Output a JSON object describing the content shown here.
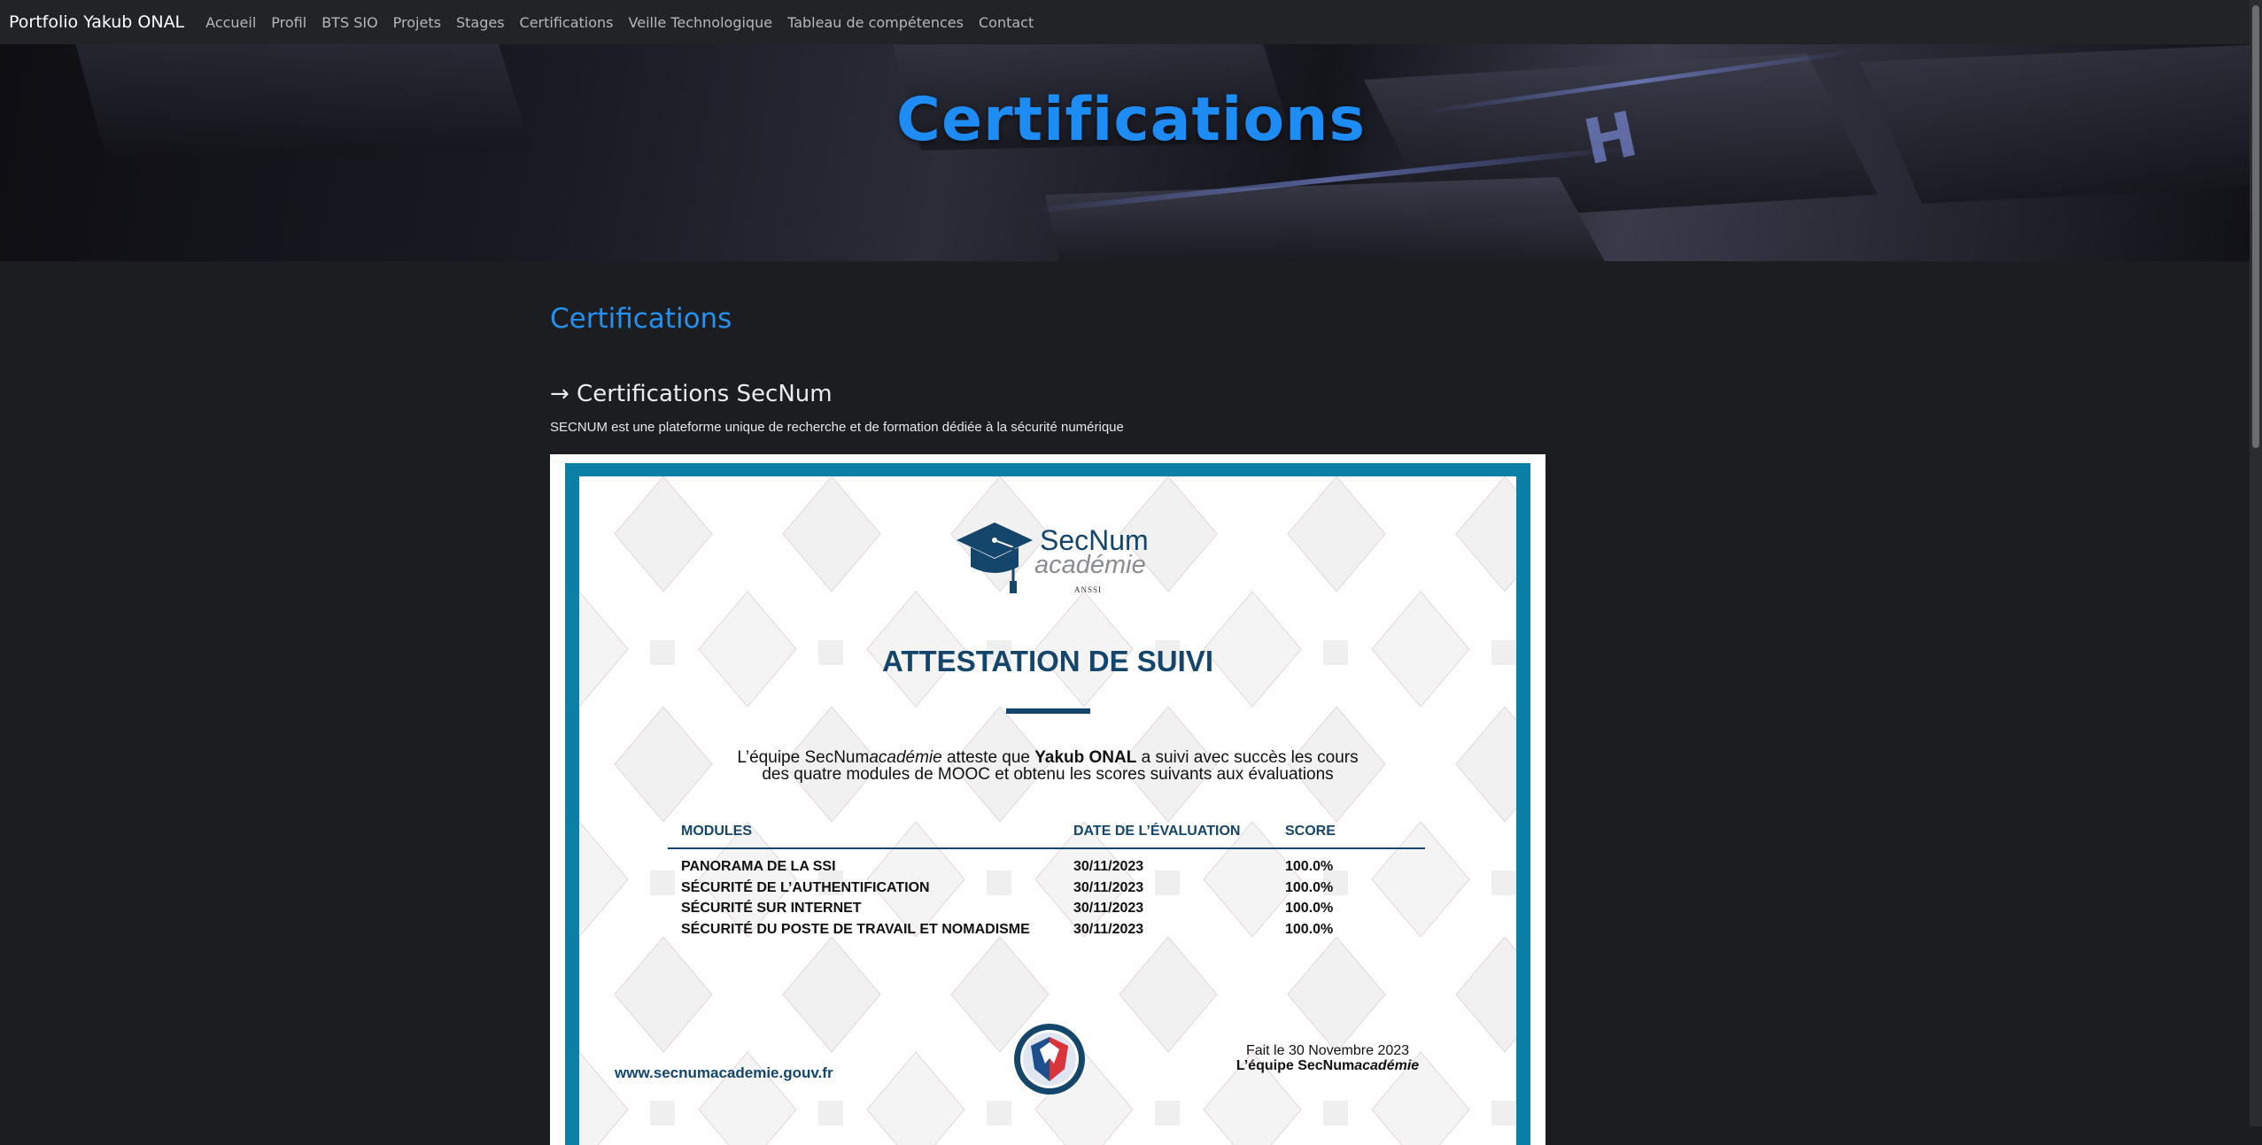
{
  "nav": {
    "brand": "Portfolio Yakub ONAL",
    "links": [
      "Accueil",
      "Profil",
      "BTS SIO",
      "Projets",
      "Stages",
      "Certifications",
      "Veille Technologique",
      "Tableau de compétences",
      "Contact"
    ]
  },
  "hero": {
    "title": "Certifications"
  },
  "main": {
    "section_title": "Certifications",
    "subsection_title": "→ Certifications SecNum",
    "description": "SECNUM est une plateforme unique de recherche et de formation dédiée à la sécurité numérique"
  },
  "certificate": {
    "logo_name": "SecNum",
    "logo_sub": "académie",
    "logo_org": "ANSSI",
    "heading": "ATTESTATION DE SUIVI",
    "body_part1": "L’équipe SecNum",
    "body_part1_italic": "académie",
    "body_part2": " atteste que ",
    "body_name": "Yakub ONAL",
    "body_part3": " a suivi avec succès les cours",
    "body_line2": "des quatre modules de MOOC et obtenu les scores suivants aux évaluations",
    "table": {
      "headers": [
        "MODULES",
        "DATE DE L’ÉVALUATION",
        "SCORE"
      ],
      "rows": [
        [
          "PANORAMA DE LA SSI",
          "30/11/2023",
          "100.0%"
        ],
        [
          "SÉCURITÉ DE L’AUTHENTIFICATION",
          "30/11/2023",
          "100.0%"
        ],
        [
          "SÉCURITÉ SUR INTERNET",
          "30/11/2023",
          "100.0%"
        ],
        [
          "SÉCURITÉ DU POSTE DE TRAVAIL ET NOMADISME",
          "30/11/2023",
          "100.0%"
        ]
      ]
    },
    "url": "www.secnumacademie.gouv.fr",
    "signature_date": "Fait le 30 Novembre 2023",
    "signature_team": "L’équipe SecNum",
    "signature_team_italic": "académie"
  },
  "colors": {
    "accent": "#1e8cf5",
    "navy": "#14466c",
    "frame_teal": "#0b7fa6",
    "page_bg": "#1b1d20"
  }
}
